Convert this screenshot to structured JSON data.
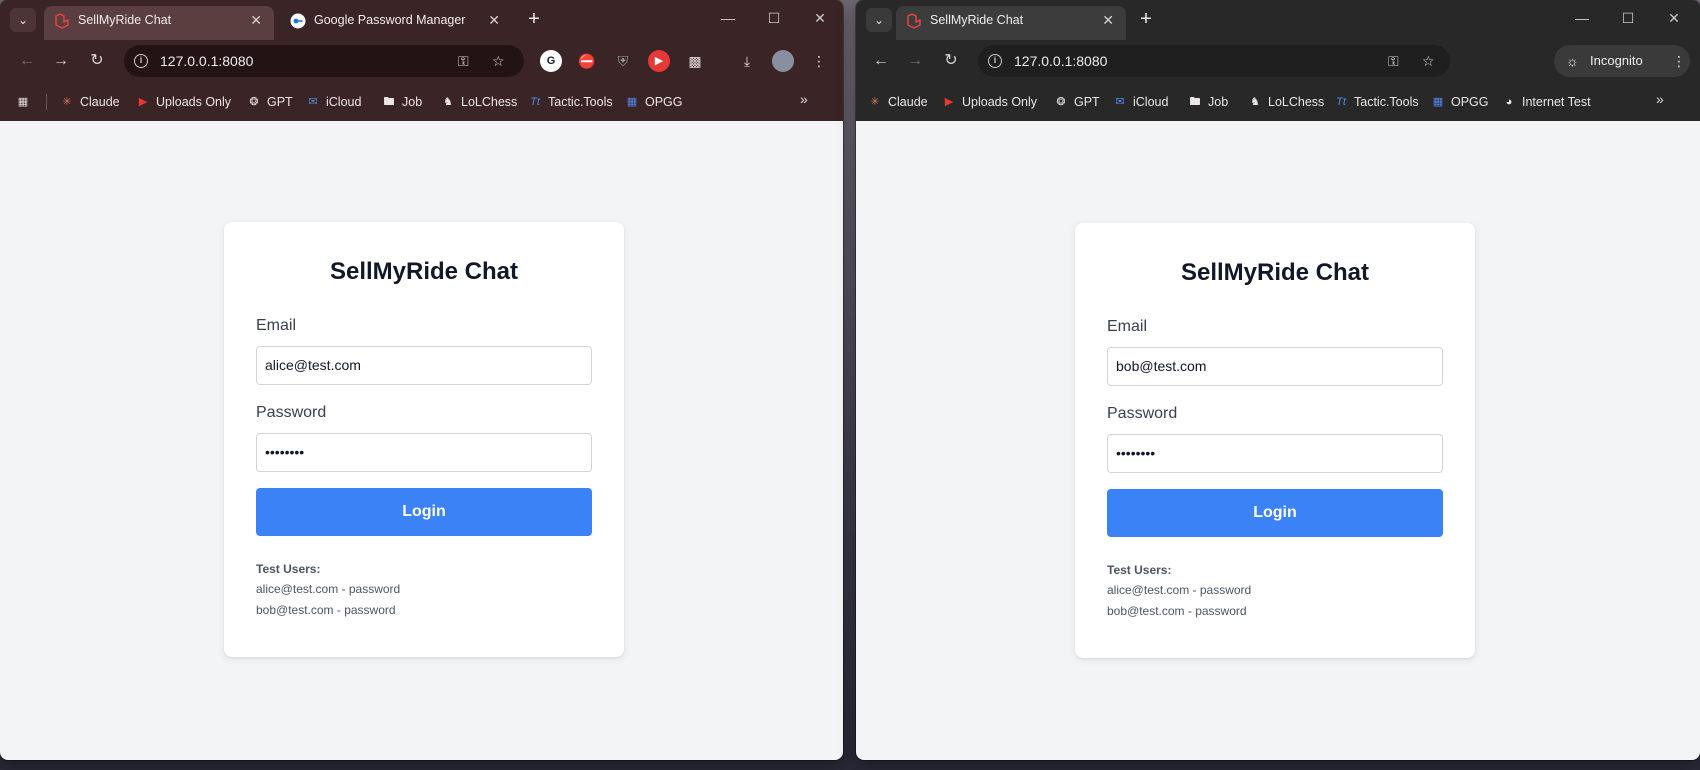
{
  "windows": [
    {
      "id": "left",
      "tabs": [
        {
          "label": "SellMyRide Chat",
          "active": true
        },
        {
          "label": "Google Password Manager",
          "active": false
        }
      ],
      "url": "127.0.0.1:8080",
      "bookmarks": [
        "Claude",
        "Uploads Only",
        "GPT",
        "iCloud",
        "Job",
        "LoLChess",
        "Tactic.Tools",
        "OPGG"
      ],
      "card": {
        "title": "SellMyRide Chat",
        "email_label": "Email",
        "email_value": "alice@test.com",
        "password_label": "Password",
        "password_value": "••••••••",
        "login_label": "Login",
        "test_users_title": "Test Users:",
        "test_user_1": "alice@test.com - password",
        "test_user_2": "bob@test.com - password"
      }
    },
    {
      "id": "right",
      "tabs": [
        {
          "label": "SellMyRide Chat",
          "active": true
        }
      ],
      "url": "127.0.0.1:8080",
      "incognito_label": "Incognito",
      "bookmarks": [
        "Claude",
        "Uploads Only",
        "GPT",
        "iCloud",
        "Job",
        "LoLChess",
        "Tactic.Tools",
        "OPGG",
        "Internet Test"
      ],
      "card": {
        "title": "SellMyRide Chat",
        "email_label": "Email",
        "email_value": "bob@test.com",
        "password_label": "Password",
        "password_value": "••••••••",
        "login_label": "Login",
        "test_users_title": "Test Users:",
        "test_user_1": "alice@test.com - password",
        "test_user_2": "bob@test.com - password"
      }
    }
  ],
  "colors": {
    "login_button": "#3b82f6",
    "page_background": "#f3f4f6",
    "left_frame": "#3b2426",
    "right_frame": "#282828"
  }
}
